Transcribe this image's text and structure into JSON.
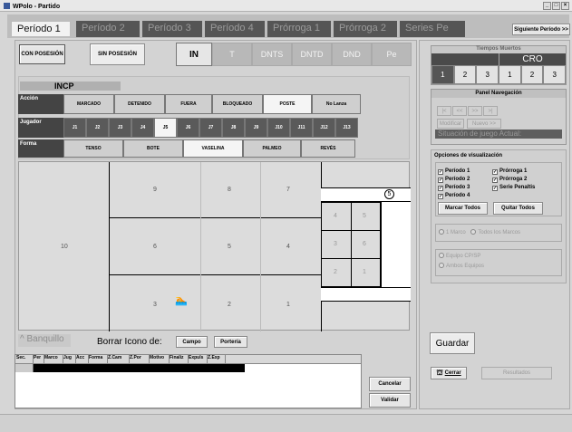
{
  "window": {
    "title": "WPolo - Partido",
    "controls": [
      "_",
      "□",
      "×"
    ]
  },
  "periods": [
    "Período 1",
    "Período 2",
    "Período 3",
    "Período 4",
    "Prórroga 1",
    "Prórroga 2",
    "Series Pe"
  ],
  "next_period": "Siguiente Período >>",
  "possession": {
    "con": "CON POSESIÓN",
    "sin": "SIN POSESIÓN"
  },
  "modes": [
    "IN",
    "T",
    "DNTS",
    "DNTD",
    "DND",
    "Pe"
  ],
  "incp": "INCP",
  "accion": {
    "label": "Acción",
    "items": [
      "MARCADO",
      "DETENIDO",
      "FUERA",
      "BLOQUEADO",
      "POSTE",
      "No Lanza"
    ]
  },
  "jugador": {
    "label": "Jugador",
    "items": [
      "J1",
      "J2",
      "J3",
      "J4",
      "J5",
      "J6",
      "J7",
      "J8",
      "J9",
      "J10",
      "J11",
      "J12",
      "J13"
    ]
  },
  "forma": {
    "label": "Forma",
    "items": [
      "TENSO",
      "BOTE",
      "VASELINA",
      "PALMEO",
      "REVÉS"
    ]
  },
  "zones": {
    "z1": "1",
    "z2": "2",
    "z3": "3",
    "z4": "4",
    "z5": "5",
    "z6": "6",
    "z7": "7",
    "z8": "8",
    "z9": "9",
    "z10": "10",
    "g4": "4",
    "g5": "5",
    "g3": "3",
    "g6": "6",
    "g2": "2",
    "g1": "1",
    "marker": "5"
  },
  "banquillo": "^ Banquillo",
  "borrar": {
    "label": "Borrar Icono de:",
    "campo": "Campo",
    "porteria": "Portería"
  },
  "table_headers": [
    "Sec.",
    "Per",
    "Marco",
    "Jug",
    "Acc",
    "Forma",
    "Z.Cam",
    "Z.Por",
    "Motivo",
    "Finaliz",
    "Expuls",
    "Z.Exp"
  ],
  "cancelar": "Cancelar",
  "validar": "Validar",
  "timeouts": {
    "title": "Tiempos Muertos",
    "team_right": "CRO",
    "cells": [
      "1",
      "2",
      "3",
      "1",
      "2",
      "3"
    ]
  },
  "nav": {
    "title": "Panel Navegación",
    "buttons": [
      "|<",
      "<<",
      ">>",
      ">|"
    ],
    "modificar": "Modificar",
    "nuevo": "Nuevo >>",
    "situacion": "Situación de juego Actual:"
  },
  "vis": {
    "title": "Opciones de visualización",
    "left": [
      "Período 1",
      "Período 2",
      "Período 3",
      "Período 4"
    ],
    "right": [
      "Prórroga 1",
      "Prórroga 2",
      "Serie Penaltis"
    ],
    "marcar": "Marcar Todos",
    "quitar": "Quitar Todos",
    "marco1": "1 Marco",
    "todos_marcos": "Todos los Marcos",
    "equipo": "Equipo CP/SP",
    "ambos": "Ambos Equipos"
  },
  "guardar": "Guardar",
  "cerrar": "Cerrar",
  "resultados": "Resultados"
}
